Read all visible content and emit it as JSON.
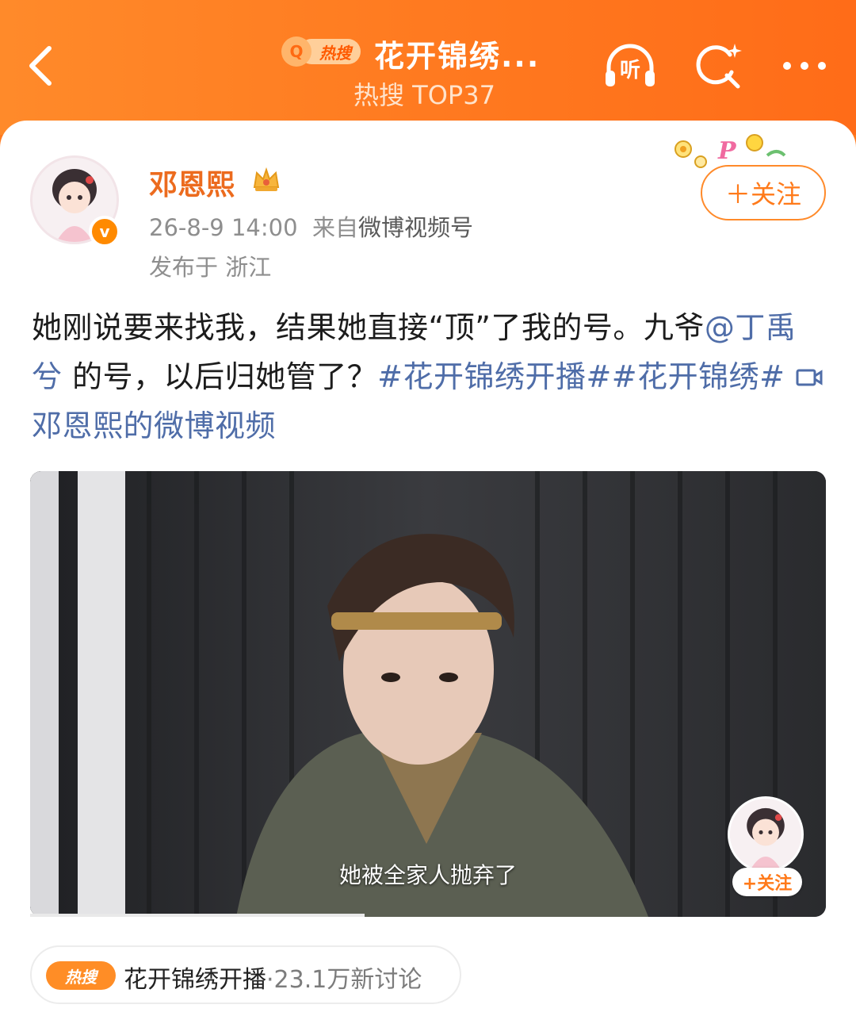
{
  "colors": {
    "brand_orange": "#ff7a1e",
    "link_blue": "#4f6da8",
    "name_orange": "#ec6b1e"
  },
  "header": {
    "back_icon": "chevron-left-icon",
    "hot_badge_label": "热搜",
    "title": "花开锦绣...",
    "subtitle": "热搜 TOP37",
    "icons": [
      "listen-icon",
      "search-sparkle-icon",
      "more-icon"
    ],
    "listen_label": "听"
  },
  "post": {
    "author": "邓恩熙",
    "verified_badge": "v",
    "meta_time": "26-8-9 14:00",
    "meta_from": "来自",
    "meta_source": "微博视频号",
    "location": "发布于 浙江",
    "follow_label": "＋关注",
    "text_parts": {
      "p1": "她刚说要来找我，结果她直接“顶”了我的号。九爷",
      "mention": "@丁禹兮",
      "p2": " 的号，以后归她管了？",
      "tag1": "#花开锦绣开播#",
      "tag2": "#花开锦绣#",
      "video_link": "邓恩熙的微博视频"
    }
  },
  "video": {
    "subtitle": "她被全家人抛弃了",
    "float_follow_label": "+关注",
    "progress": 0.42
  },
  "topic": {
    "badge": "热搜",
    "name": "花开锦绣开播",
    "count": "·23.1万新讨论"
  }
}
